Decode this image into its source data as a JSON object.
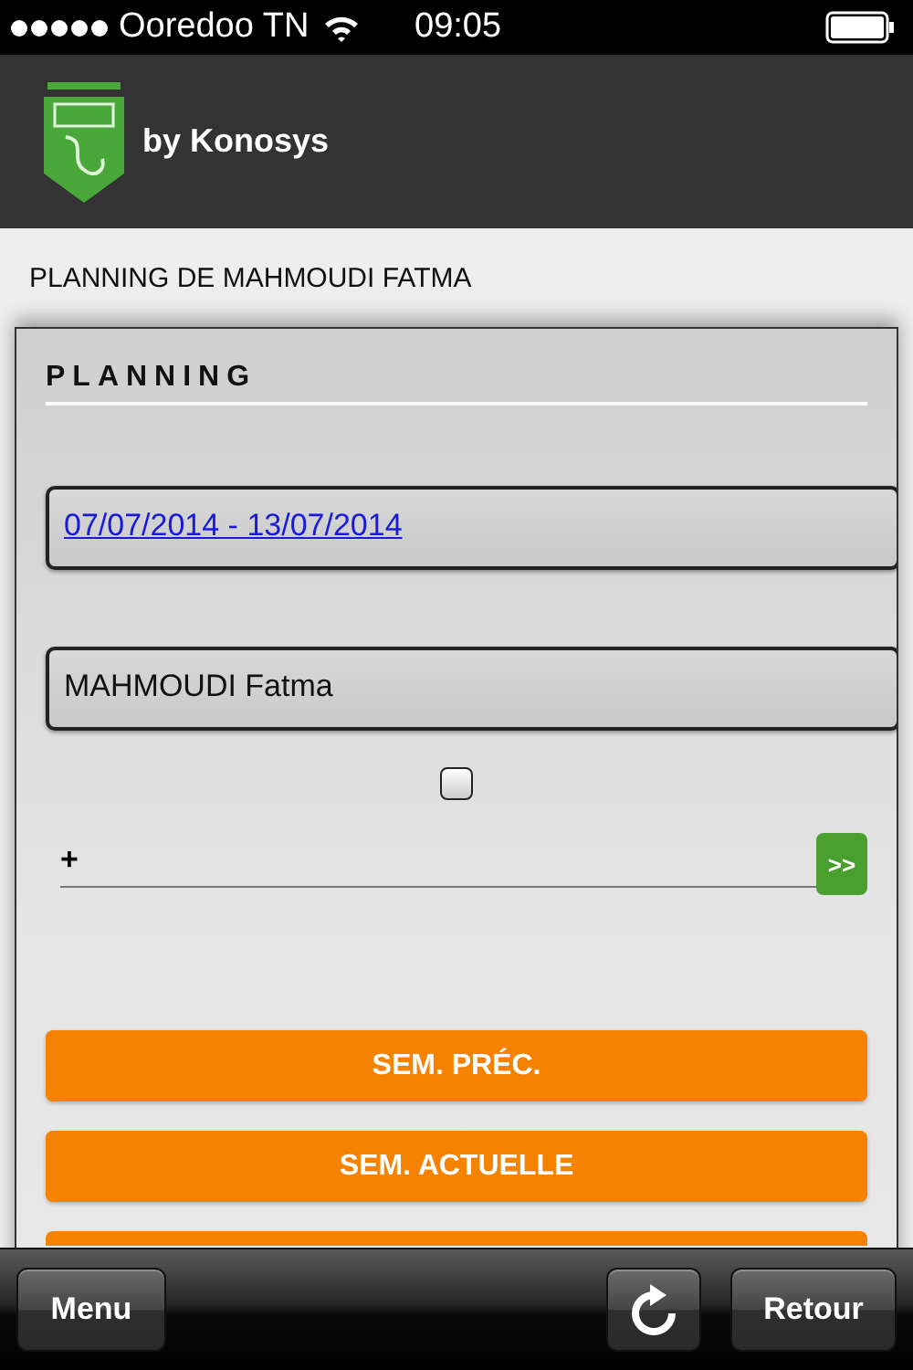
{
  "status_bar": {
    "carrier": "Ooredoo TN",
    "time": "09:05"
  },
  "header": {
    "brand": "by Konosys"
  },
  "page_title": "PLANNING DE MAHMOUDI FATMA",
  "card": {
    "title": "PLANNING",
    "date_range": "07/07/2014 - 13/07/2014",
    "employee": "MAHMOUDI Fatma",
    "checkbox": {
      "checked": false
    },
    "add_field": {
      "prefix": "+",
      "go_label": ">>"
    },
    "buttons": [
      {
        "kind": "labeled",
        "label": "SEM. PRÉC."
      },
      {
        "kind": "labeled",
        "label": "SEM. ACTUELLE"
      },
      {
        "kind": "covered"
      }
    ]
  },
  "toolbar": {
    "menu": "Menu",
    "back": "Retour"
  }
}
